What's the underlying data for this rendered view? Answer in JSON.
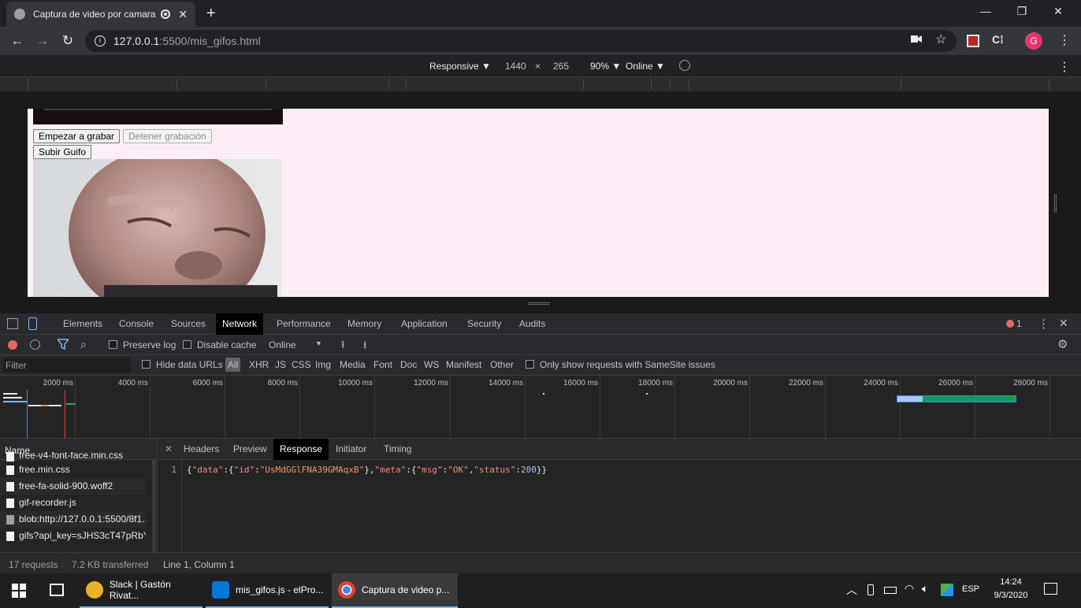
{
  "browser": {
    "tab_title": "Captura de video por camara",
    "tab_close": "✕",
    "new_tab": "+",
    "window_minimize": "—",
    "window_restore": "❐",
    "window_close": "✕",
    "url_host": "127.0.0.1",
    "url_path": ":5500/mis_gifos.html",
    "avatar_letter": "G"
  },
  "device_toolbar": {
    "mode": "Responsive ▼",
    "width": "1440",
    "times": "×",
    "height": "265",
    "zoom": "90% ▼",
    "throttle": "Online ▼"
  },
  "page": {
    "btn_start": "Empezar a grabar",
    "btn_stop": "Detener grabación",
    "btn_upload": "Subir Guifo"
  },
  "devtools": {
    "tabs": [
      "Elements",
      "Console",
      "Sources",
      "Network",
      "Performance",
      "Memory",
      "Application",
      "Security",
      "Audits"
    ],
    "active_tab": "Network",
    "error_count": "1",
    "preserve_log": "Preserve log",
    "disable_cache": "Disable cache",
    "throttle": "Online",
    "filter_placeholder": "Filter",
    "hide_data_urls": "Hide data URLs",
    "type_filters": [
      "All",
      "XHR",
      "JS",
      "CSS",
      "Img",
      "Media",
      "Font",
      "Doc",
      "WS",
      "Manifest",
      "Other"
    ],
    "samesite": "Only show requests with SameSite issues",
    "timeline_ticks": [
      "2000 ms",
      "4000 ms",
      "6000 ms",
      "8000 ms",
      "10000 ms",
      "12000 ms",
      "14000 ms",
      "16000 ms",
      "18000 ms",
      "20000 ms",
      "22000 ms",
      "24000 ms",
      "26000 ms",
      "28000 ms"
    ],
    "name_header": "Name",
    "requests": [
      "free-v4-font-face.min.css",
      "free.min.css",
      "free-fa-solid-900.woff2",
      "gif-recorder.js",
      "blob:http://127.0.0.1:5500/8f1...",
      "gifs?api_key=sJHS3cT47pRbY..."
    ],
    "detail_close": "✕",
    "detail_tabs": [
      "Headers",
      "Preview",
      "Response",
      "Initiator",
      "Timing"
    ],
    "active_detail": "Response",
    "line_number": "1",
    "status_requests": "17 requests",
    "status_transferred": "7.2 KB transferred",
    "status_position": "Line 1, Column 1"
  },
  "response_json": {
    "id": "UsMdGGlFNA39GMAqxB",
    "msg": "OK",
    "status": "200"
  },
  "taskbar": {
    "apps": [
      "Slack | Gastón Rivat...",
      "mis_gifos.js - elPro...",
      "Captura de video p..."
    ],
    "lang": "ESP",
    "time": "14:24",
    "date": "9/3/2020"
  }
}
